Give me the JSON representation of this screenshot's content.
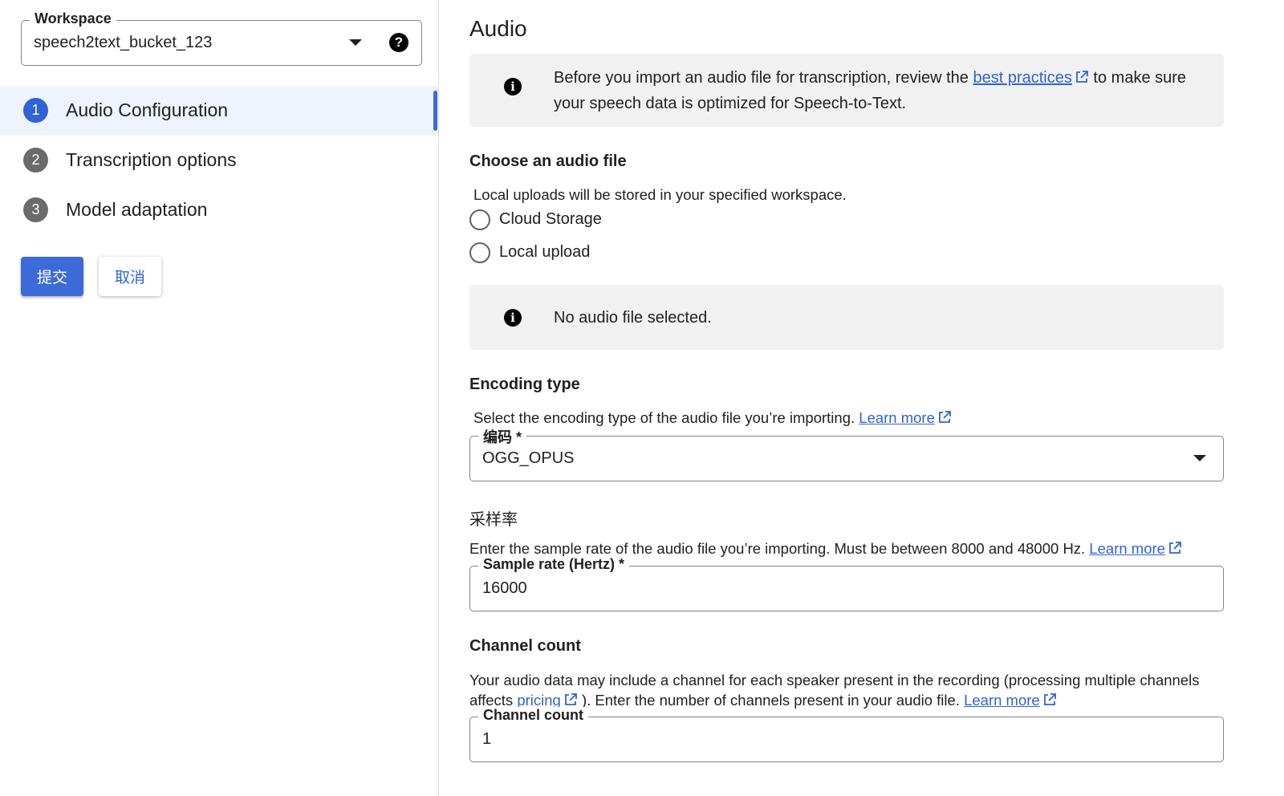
{
  "sidebar": {
    "workspace": {
      "label": "Workspace",
      "value": "speech2text_bucket_123",
      "help": "?"
    },
    "steps": [
      {
        "num": "1",
        "label": "Audio Configuration",
        "active": true
      },
      {
        "num": "2",
        "label": "Transcription options",
        "active": false
      },
      {
        "num": "3",
        "label": "Model adaptation",
        "active": false
      }
    ],
    "submit_label": "提交",
    "cancel_label": "取消"
  },
  "main": {
    "title": "Audio",
    "notice": {
      "icon": "i",
      "before": "Before you import an audio file for transcription, review the ",
      "link": "best practices",
      "after": " to make sure",
      "line2": "your speech data is optimized for Speech-to-Text."
    },
    "audio_file": {
      "title": "Choose an audio file",
      "desc": "Local uploads will be stored in your specified workspace.",
      "options": [
        "Cloud Storage",
        "Local upload"
      ],
      "status_icon": "i",
      "status": "No audio file selected."
    },
    "encoding": {
      "title": "Encoding type",
      "desc": "Select the encoding type of the audio file you’re importing. ",
      "learn_more": "Learn more",
      "field_label": "编码 *",
      "value": "OGG_OPUS"
    },
    "sample_rate": {
      "title": "采样率",
      "desc": "Enter the sample rate of the audio file you’re importing. Must be between 8000 and 48000 Hz. ",
      "learn_more": "Learn more",
      "field_label": "Sample rate (Hertz) *",
      "value": "16000"
    },
    "channel": {
      "title": "Channel count",
      "desc_line1": "Your audio data may include a channel for each speaker present in the recording (processing multiple channels",
      "desc_pre": "affects ",
      "pricing": "pricing",
      "desc_mid": " ). Enter the number of channels present in your audio file. ",
      "learn_more": "Learn more",
      "field_label": "Channel count",
      "value": "1"
    }
  },
  "colors": {
    "accent": "#3c6bd9",
    "link": "#2f63d6",
    "info_bg": "#f1f1f1",
    "active_step_bg": "#eef3fd"
  }
}
